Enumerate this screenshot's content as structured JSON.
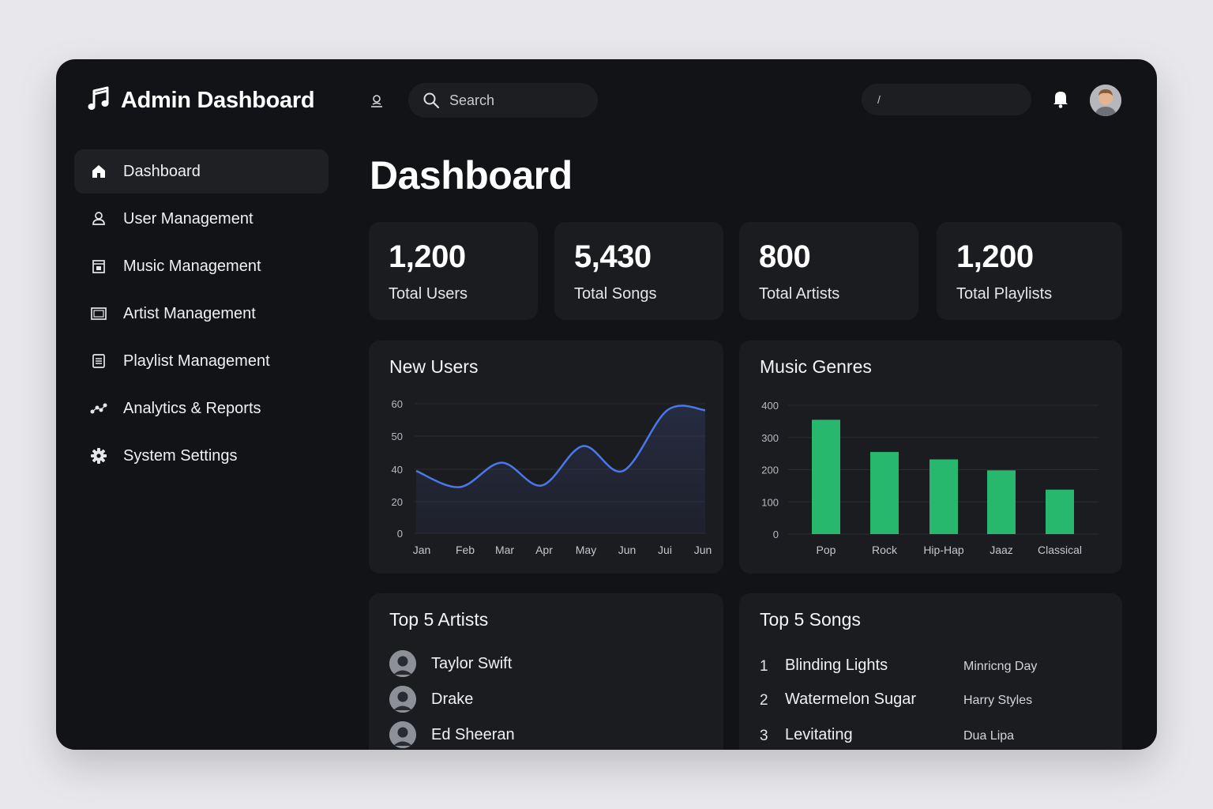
{
  "header": {
    "title": "Admin Dashboard",
    "search_placeholder": "Search",
    "pill_text": "/"
  },
  "sidebar": {
    "items": [
      {
        "label": "Dashboard",
        "icon": "home-icon",
        "active": true
      },
      {
        "label": "User Management",
        "icon": "user-icon"
      },
      {
        "label": "Music Management",
        "icon": "music-box-icon"
      },
      {
        "label": "Artist Management",
        "icon": "monitor-icon"
      },
      {
        "label": "Playlist Management",
        "icon": "list-icon"
      },
      {
        "label": "Analytics & Reports",
        "icon": "analytics-icon"
      },
      {
        "label": "System Settings",
        "icon": "gear-icon"
      }
    ]
  },
  "main": {
    "title": "Dashboard",
    "stats": [
      {
        "value": "1,200",
        "label": "Total Users"
      },
      {
        "value": "5,430",
        "label": "Total Songs"
      },
      {
        "value": "800",
        "label": "Total Artists"
      },
      {
        "value": "1,200",
        "label": "Total Playlists"
      }
    ],
    "top_artists": {
      "title": "Top 5 Artists",
      "items": [
        "Taylor Swift",
        "Drake",
        "Ed Sheeran"
      ]
    },
    "top_songs": {
      "title": "Top 5 Songs",
      "items": [
        {
          "rank": "1",
          "title": "Blinding Lights",
          "artist": "Minricng Day"
        },
        {
          "rank": "2",
          "title": "Watermelon Sugar",
          "artist": "Harry Styles"
        },
        {
          "rank": "3",
          "title": "Levitating",
          "artist": "Dua Lipa"
        }
      ]
    }
  },
  "colors": {
    "background": "#121316",
    "card": "#1b1c20",
    "line": "#4a78e8",
    "bar": "#27b86d"
  },
  "chart_data": [
    {
      "type": "line",
      "title": "New Users",
      "categories": [
        "Jan",
        "Feb",
        "Mar",
        "Apr",
        "May",
        "Jun",
        "Jui",
        "Jun"
      ],
      "values": [
        39,
        29,
        42,
        30,
        47,
        39,
        58,
        58
      ],
      "y_ticks": [
        "0",
        "20",
        "40",
        "50",
        "60"
      ],
      "grid": true,
      "area_fill": true
    },
    {
      "type": "bar",
      "title": "Music Genres",
      "categories": [
        "Pop",
        "Rock",
        "Hip-Hap",
        "Jaaz",
        "Classical"
      ],
      "values": [
        355,
        255,
        232,
        198,
        138
      ],
      "y_ticks": [
        "0",
        "100",
        "200",
        "300",
        "400"
      ],
      "ylim": [
        0,
        400
      ],
      "grid": true
    }
  ]
}
